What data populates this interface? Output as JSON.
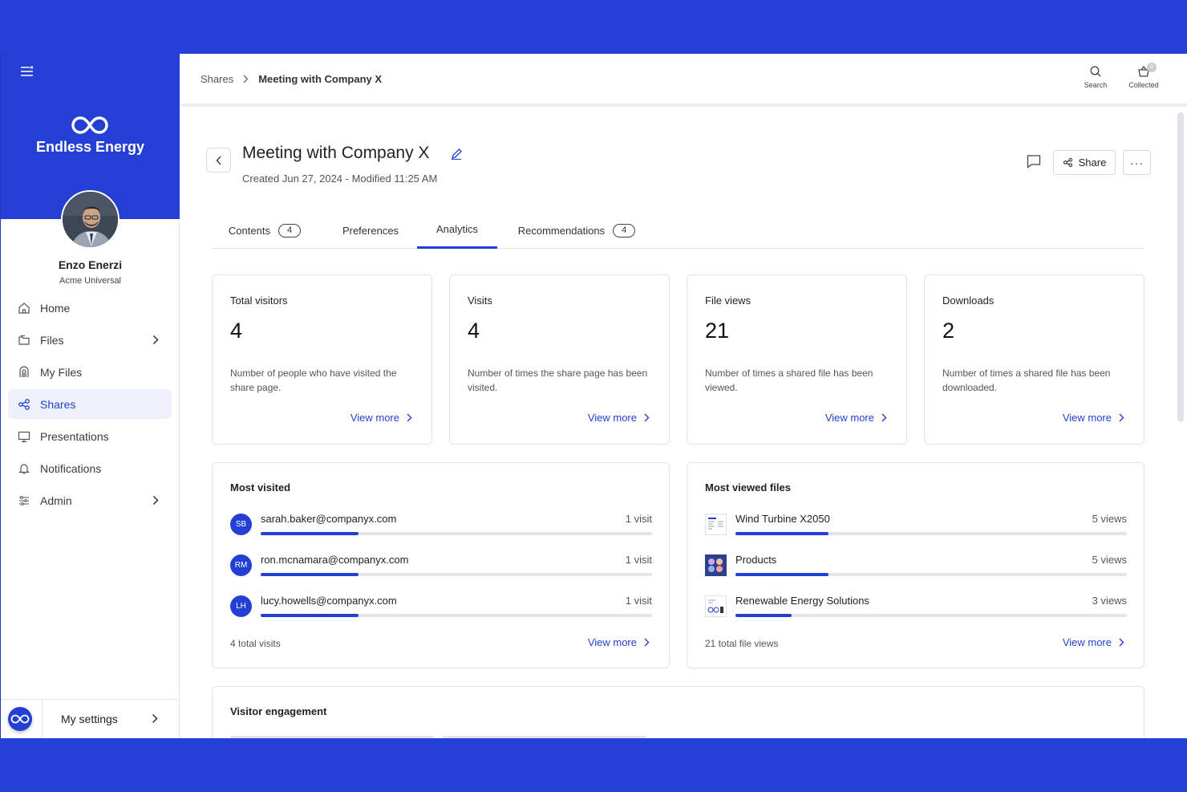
{
  "sidebar": {
    "brand": "Endless Energy",
    "user_name": "Enzo Enerzi",
    "user_org": "Acme Universal",
    "items": [
      {
        "label": "Home",
        "icon": "home-icon",
        "has_chevron": false,
        "active": false
      },
      {
        "label": "Files",
        "icon": "files-icon",
        "has_chevron": true,
        "active": false
      },
      {
        "label": "My Files",
        "icon": "my-files-icon",
        "has_chevron": false,
        "active": false
      },
      {
        "label": "Shares",
        "icon": "share-icon",
        "has_chevron": false,
        "active": true
      },
      {
        "label": "Presentations",
        "icon": "presentation-icon",
        "has_chevron": false,
        "active": false
      },
      {
        "label": "Notifications",
        "icon": "bell-icon",
        "has_chevron": false,
        "active": false
      },
      {
        "label": "Admin",
        "icon": "sliders-icon",
        "has_chevron": true,
        "active": false
      }
    ],
    "settings_label": "My settings"
  },
  "topbar": {
    "breadcrumb": [
      "Shares",
      "Meeting with Company X"
    ],
    "search_label": "Search",
    "collected_label": "Collected",
    "collected_count": "0"
  },
  "header": {
    "title": "Meeting with Company X",
    "meta": "Created Jun 27, 2024 - Modified 11:25 AM",
    "share_label": "Share",
    "more_label": "···"
  },
  "tabs": [
    {
      "label": "Contents",
      "count": "4",
      "active": false
    },
    {
      "label": "Preferences",
      "count": null,
      "active": false
    },
    {
      "label": "Analytics",
      "count": null,
      "active": true
    },
    {
      "label": "Recommendations",
      "count": "4",
      "active": false
    }
  ],
  "stats": [
    {
      "label": "Total visitors",
      "value": "4",
      "desc": "Number of people who have visited the share page.",
      "link": "View more"
    },
    {
      "label": "Visits",
      "value": "4",
      "desc": "Number of times the share page has been visited.",
      "link": "View more"
    },
    {
      "label": "File views",
      "value": "21",
      "desc": "Number of times a shared file has been viewed.",
      "link": "View more"
    },
    {
      "label": "Downloads",
      "value": "2",
      "desc": "Number of times a shared file has been downloaded.",
      "link": "View more"
    }
  ],
  "most_visited": {
    "title": "Most visited",
    "rows": [
      {
        "initials": "SB",
        "name": "sarah.baker@companyx.com",
        "value": "1 visit",
        "fill": 0.25
      },
      {
        "initials": "RM",
        "name": "ron.mcnamara@companyx.com",
        "value": "1 visit",
        "fill": 0.25
      },
      {
        "initials": "LH",
        "name": "lucy.howells@companyx.com",
        "value": "1 visit",
        "fill": 0.25
      }
    ],
    "total": "4 total visits",
    "link": "View more"
  },
  "most_viewed_files": {
    "title": "Most viewed files",
    "rows": [
      {
        "name": "Wind Turbine X2050",
        "value": "5 views",
        "fill": 0.238
      },
      {
        "name": "Products",
        "value": "5 views",
        "fill": 0.238
      },
      {
        "name": "Renewable Energy Solutions",
        "value": "3 views",
        "fill": 0.143
      }
    ],
    "total": "21 total file views",
    "link": "View more"
  },
  "engagement": {
    "title": "Visitor engagement"
  },
  "colors": {
    "accent": "#2440d4",
    "bar_track": "#e3e5ea"
  }
}
